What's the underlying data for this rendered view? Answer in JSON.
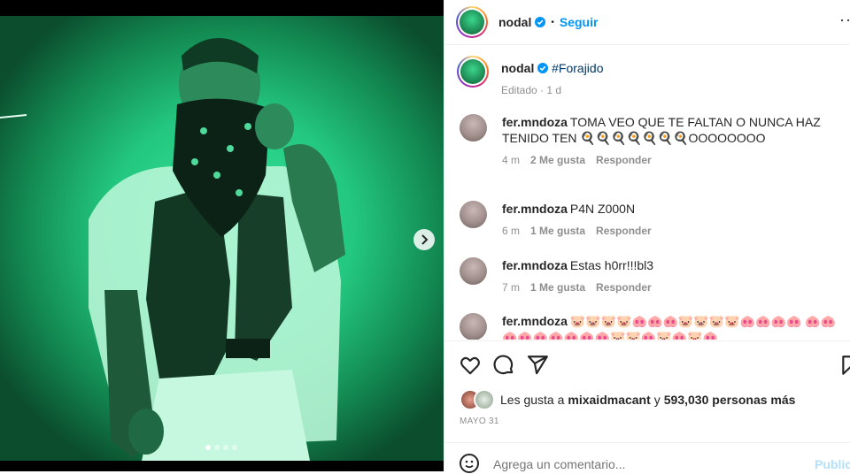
{
  "post": {
    "username": "nodal",
    "follow_label": "Seguir",
    "more_label": "··",
    "caption_hashtag": "#Forajido",
    "caption_meta": "Editado · 1 d"
  },
  "comments": [
    {
      "user": "fer.mndoza",
      "text": "TOMA VEO QUE TE FALTAN O NUNCA HAZ TENIDO TEN 🍳🍳🍳🍳🍳🍳🍳OOOOOOOO",
      "time": "4 m",
      "likes": "2 Me gusta",
      "reply": "Responder"
    },
    {
      "user": "fer.mndoza",
      "text": "P4N Z000N",
      "time": "6 m",
      "likes": "1 Me gusta",
      "reply": "Responder"
    },
    {
      "user": "fer.mndoza",
      "text": "Estas h0rr!!!bl3",
      "time": "7 m",
      "likes": "1 Me gusta",
      "reply": "Responder"
    },
    {
      "user": "fer.mndoza",
      "text": "🐷🐷🐷🐷🐽🐽🐽🐷🐷🐷🐷🐽🐽🐽🐽 🐽🐽🐽🐽🐽🐽🐽🐽🐽🐷🐷🐽🐷🐽🐷🐽",
      "time": "",
      "likes": "",
      "reply": ""
    }
  ],
  "likes": {
    "prefix": "Les gusta a",
    "user": "mixaidmacant",
    "middle": "y",
    "count": "593,030 personas más"
  },
  "date": "MAYO 31",
  "add_comment": {
    "placeholder": "Agrega un comentario...",
    "publish": "Publicar"
  },
  "colors": {
    "accent": "#0095f6",
    "verified": "#0095f6",
    "hashtag": "#00376b",
    "photo_green": "#23c77f"
  },
  "icons": [
    "heart-icon",
    "comment-icon",
    "share-icon",
    "save-icon",
    "emoji-icon",
    "chevron-right-icon",
    "verified-icon"
  ],
  "carousel": {
    "count": 4,
    "active": 0
  }
}
